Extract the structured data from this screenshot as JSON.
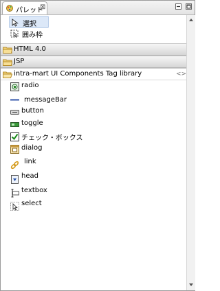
{
  "view": {
    "tab_title": "パレット",
    "close_glyph": "⊠"
  },
  "tools": [
    {
      "label": "選択",
      "icon": "arrow-select-icon",
      "selected": true
    },
    {
      "label": "囲み枠",
      "icon": "marquee-icon",
      "selected": false
    }
  ],
  "drawers": [
    {
      "label": "HTML 4.0",
      "open": false
    },
    {
      "label": "JSP",
      "open": false
    },
    {
      "label": "intra-mart UI Components Tag library",
      "open": true
    }
  ],
  "entries": [
    {
      "label": "radio",
      "icon": "radio-icon"
    },
    {
      "label": "messageBar",
      "icon": "message-bar-icon"
    },
    {
      "label": "button",
      "icon": "button-icon"
    },
    {
      "label": "toggle",
      "icon": "toggle-icon"
    },
    {
      "label": "チェック・ボックス",
      "icon": "checkbox-icon"
    },
    {
      "label": "dialog",
      "icon": "dialog-icon"
    },
    {
      "label": "link",
      "icon": "link-icon"
    },
    {
      "label": "head",
      "icon": "head-icon"
    },
    {
      "label": "textbox",
      "icon": "textbox-icon"
    },
    {
      "label": "select",
      "icon": "select-icon"
    }
  ],
  "colors": {
    "selection": "#dce8f8",
    "folder": "#f0c75a"
  }
}
